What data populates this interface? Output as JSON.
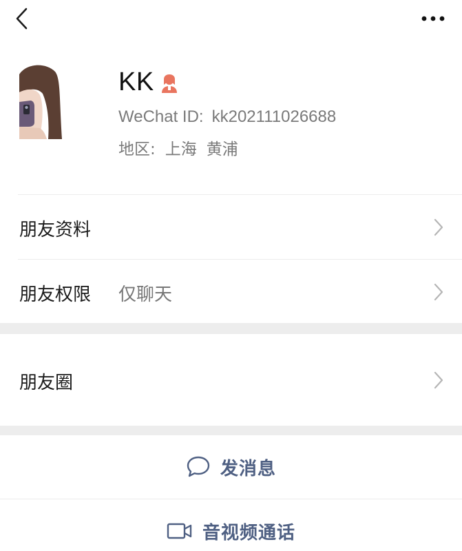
{
  "header": {
    "back_icon": "chevron-left-icon",
    "more_icon": "ellipsis-icon"
  },
  "profile": {
    "name": "KK",
    "gender_icon": "person-female-icon",
    "gender_color": "#e9755f",
    "wechat_id_label": "WeChat ID:",
    "wechat_id": "kk202111026688",
    "region_label": "地区:",
    "region_city": "上海",
    "region_district": "黄浦"
  },
  "rows": {
    "friend_info": {
      "label": "朋友资料"
    },
    "permissions": {
      "label": "朋友权限",
      "value": "仅聊天"
    },
    "moments": {
      "label": "朋友圈"
    }
  },
  "actions": {
    "message": {
      "label": "发消息",
      "icon": "chat-bubble-icon"
    },
    "call": {
      "label": "音视频通话",
      "icon": "video-camera-icon"
    }
  },
  "colors": {
    "accent": "#4f6083",
    "secondary_text": "#7a7a7a",
    "band": "#ededed"
  }
}
